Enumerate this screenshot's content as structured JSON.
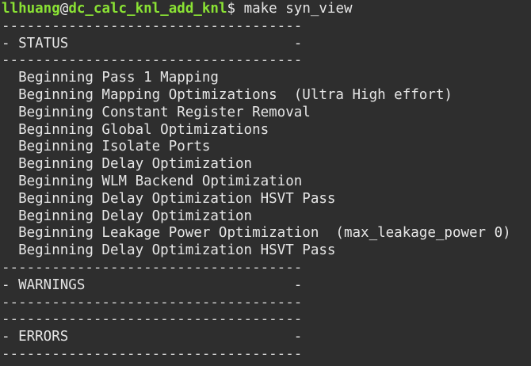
{
  "prompt": {
    "user": "llhuang",
    "at": "@",
    "host": "dc_calc_knl_add_knl",
    "symbol": "$ ",
    "command": "make syn_view"
  },
  "lines": [
    "------------------------------------",
    "- STATUS                           -",
    "------------------------------------",
    "  Beginning Pass 1 Mapping",
    "  Beginning Mapping Optimizations  (Ultra High effort)",
    "  Beginning Constant Register Removal",
    "  Beginning Global Optimizations",
    "  Beginning Isolate Ports",
    "  Beginning Delay Optimization",
    "  Beginning WLM Backend Optimization",
    "  Beginning Delay Optimization HSVT Pass",
    "  Beginning Delay Optimization",
    "  Beginning Leakage Power Optimization  (max_leakage_power 0)",
    "  Beginning Delay Optimization HSVT Pass",
    "------------------------------------",
    "- WARNINGS                         -",
    "------------------------------------",
    "------------------------------------",
    "- ERRORS                           -",
    "------------------------------------"
  ],
  "colors": {
    "background": "#2e2e2e",
    "foreground": "#e6e6e6",
    "prompt_green": "#8ae234"
  }
}
